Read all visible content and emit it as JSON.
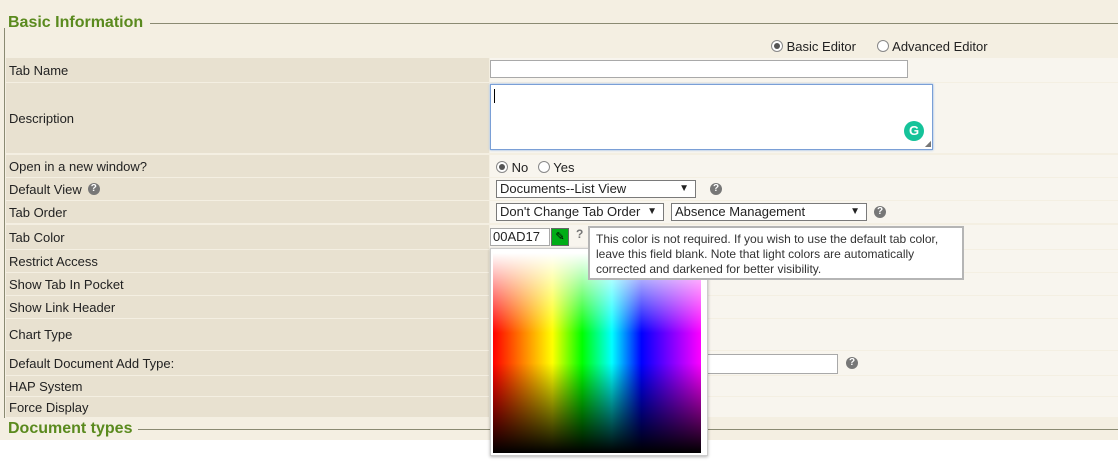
{
  "sections": {
    "basic": "Basic Information",
    "doc_types": "Document types"
  },
  "editor_mode": {
    "basic_label": "Basic Editor",
    "advanced_label": "Advanced Editor",
    "selected": "basic"
  },
  "fields": {
    "tab_name": {
      "label": "Tab Name",
      "value": ""
    },
    "description": {
      "label": "Description",
      "value": ""
    },
    "open_new_window": {
      "label": "Open in a new window?",
      "no": "No",
      "yes": "Yes",
      "selected": "no"
    },
    "default_view": {
      "label": "Default View",
      "value": "Documents--List View"
    },
    "tab_order": {
      "label": "Tab Order",
      "value": "Don't Change Tab Order",
      "position_value": "Absence Management"
    },
    "tab_color": {
      "label": "Tab Color",
      "value": "00AD17",
      "swatch": "#00AD17"
    },
    "restrict_access": {
      "label": "Restrict Access"
    },
    "show_tab_in_pocket": {
      "label": "Show Tab In Pocket"
    },
    "show_link_header": {
      "label": "Show Link Header"
    },
    "chart_type": {
      "label": "Chart Type"
    },
    "default_doc_add_type": {
      "label": "Default Document Add Type:"
    },
    "hap_system": {
      "label": "HAP System"
    },
    "force_display": {
      "label": "Force Display"
    }
  },
  "tooltip": {
    "text": "This color is not required. If you wish to use the default tab color, leave this field blank. Note that light colors are automatically corrected and darkened for better visibility."
  },
  "icons": {
    "help": "?",
    "select_arrow": "▼"
  },
  "colors": {
    "accent": "#5a8a1e",
    "grammarly": "#15c39a"
  }
}
